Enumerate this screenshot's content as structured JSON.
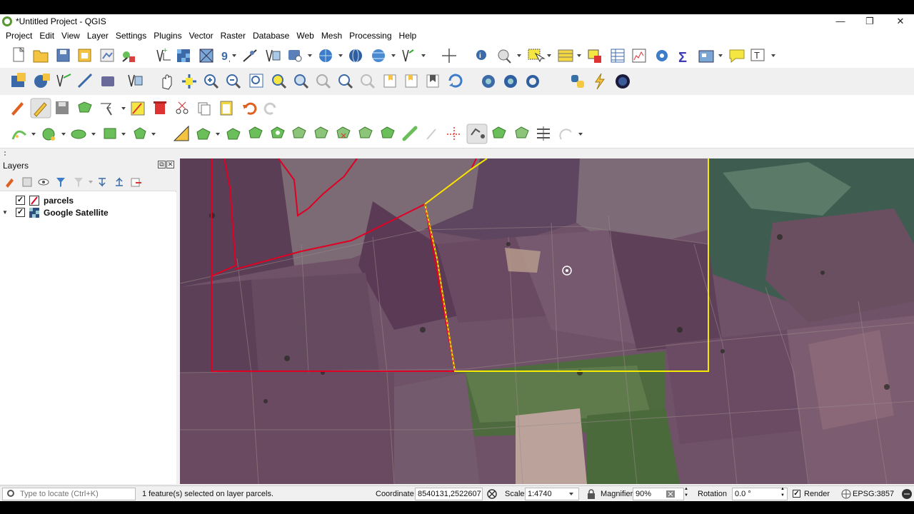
{
  "window": {
    "title": "*Untitled Project - QGIS",
    "minimize": "—",
    "restore": "❐",
    "close": "✕"
  },
  "menu": [
    "Project",
    "Edit",
    "View",
    "Layer",
    "Settings",
    "Plugins",
    "Vector",
    "Raster",
    "Database",
    "Web",
    "Mesh",
    "Processing",
    "Help"
  ],
  "layers_panel": {
    "title": "Layers",
    "float": "⧉",
    "close": "✕",
    "layers": [
      {
        "name": "parcels",
        "checked": "✓",
        "expand": "",
        "icon": "polygon-layer-icon"
      },
      {
        "name": "Google Satellite",
        "checked": "✓",
        "expand": "▼",
        "icon": "raster-layer-icon"
      }
    ]
  },
  "status": {
    "locator_placeholder": "Type to locate (Ctrl+K)",
    "message": "1 feature(s) selected on layer parcels.",
    "coordinate_label": "Coordinate",
    "coordinate": "8540131,2522607",
    "scale_label": "Scale",
    "scale": "1:4740",
    "magnifier_label": "Magnifier",
    "magnifier": "90%",
    "rotation_label": "Rotation",
    "rotation": "0.0 °",
    "render_label": "Render",
    "render_checked": "✓",
    "crs": "EPSG:3857"
  },
  "colors": {
    "selection": "#f2ea00",
    "parcel_outline": "#e00024",
    "qgis_green": "#589632"
  }
}
